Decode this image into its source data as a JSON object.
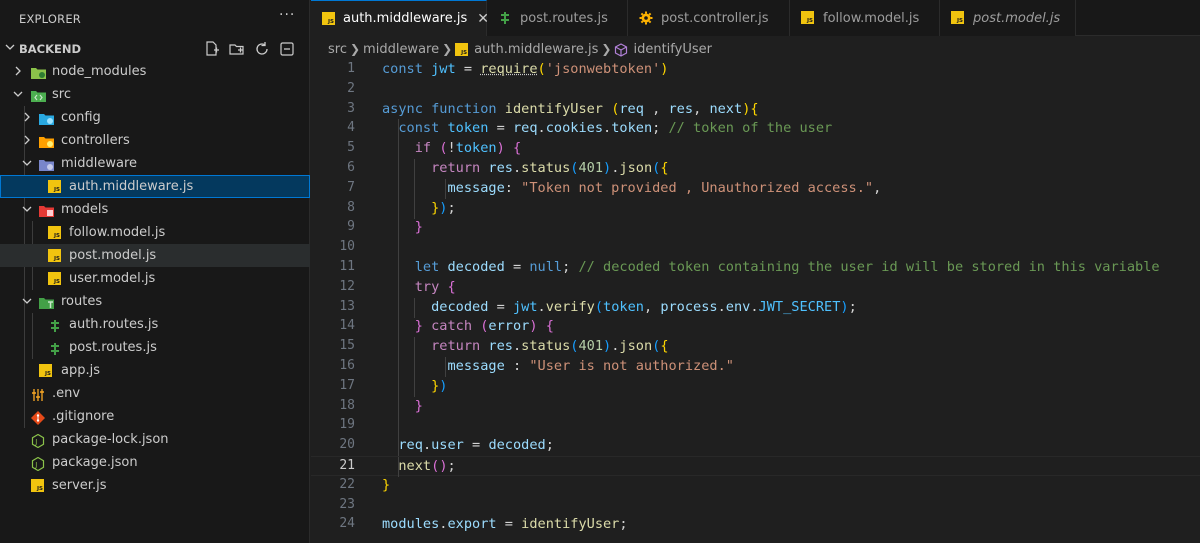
{
  "explorer": {
    "title": "EXPLORER",
    "more": "···",
    "root": "BACKEND",
    "tree": [
      {
        "label": "node_modules",
        "icon": "node-folder-icon"
      },
      {
        "label": "src",
        "icon": "src-folder-icon"
      },
      {
        "label": "config",
        "icon": "config-folder-icon"
      },
      {
        "label": "controllers",
        "icon": "controllers-folder-icon"
      },
      {
        "label": "middleware",
        "icon": "middleware-folder-icon"
      },
      {
        "label": "auth.middleware.js",
        "icon": "js-file-icon"
      },
      {
        "label": "models",
        "icon": "models-folder-icon"
      },
      {
        "label": "follow.model.js",
        "icon": "js-file-icon"
      },
      {
        "label": "post.model.js",
        "icon": "js-file-icon"
      },
      {
        "label": "user.model.js",
        "icon": "js-file-icon"
      },
      {
        "label": "routes",
        "icon": "routes-folder-icon"
      },
      {
        "label": "auth.routes.js",
        "icon": "routes-file-icon"
      },
      {
        "label": "post.routes.js",
        "icon": "routes-file-icon"
      },
      {
        "label": "app.js",
        "icon": "js-file-icon"
      },
      {
        "label": ".env",
        "icon": "env-file-icon"
      },
      {
        "label": ".gitignore",
        "icon": "git-icon"
      },
      {
        "label": "package-lock.json",
        "icon": "npm-file-icon"
      },
      {
        "label": "package.json",
        "icon": "npm-file-icon"
      },
      {
        "label": "server.js",
        "icon": "js-file-icon"
      }
    ]
  },
  "tabs": [
    {
      "label": "auth.middleware.js",
      "icon": "js-file-icon",
      "close": "✕"
    },
    {
      "label": "post.routes.js",
      "icon": "routes-file-icon"
    },
    {
      "label": "post.controller.js",
      "icon": "gear-icon"
    },
    {
      "label": "follow.model.js",
      "icon": "js-file-icon"
    },
    {
      "label": "post.model.js",
      "icon": "js-file-icon"
    }
  ],
  "breadcrumb": {
    "src": "src",
    "folder": "middleware",
    "file": "auth.middleware.js",
    "symbol": "identifyUser"
  },
  "editor": {
    "line_numbers": [
      "1",
      "2",
      "3",
      "4",
      "5",
      "6",
      "7",
      "8",
      "9",
      "10",
      "11",
      "12",
      "13",
      "14",
      "15",
      "16",
      "17",
      "18",
      "19",
      "20",
      "21",
      "22",
      "23",
      "24"
    ],
    "current_line": "21",
    "code": {
      "l1_kw": "const",
      "l1_var": "jwt",
      "l1_eq": " = ",
      "l1_fn": "require",
      "l1_po": "(",
      "l1_str": "'jsonwebtoken'",
      "l1_pc": ")",
      "l3_async": "async",
      "l3_function": "function",
      "l3_name": "identifyUser",
      "l3_po": "(",
      "l3_req": "req",
      "l3_c1": " , ",
      "l3_res": "res",
      "l3_c2": ", ",
      "l3_next": "next",
      "l3_pc": ")",
      "l3_bo": "{",
      "l4_kw": "const",
      "l4_var": "token",
      "l4_eq": " = ",
      "l4_obj": "req",
      "l4_d1": ".",
      "l4_prop": "cookies",
      "l4_d2": ".",
      "l4_prop2": "token",
      "l4_semi": "; ",
      "l4_comment": "// token of the user",
      "l5_if": "if",
      "l5_po": "(",
      "l5_not": "!",
      "l5_tok": "token",
      "l5_pc": ")",
      "l5_bo": "{",
      "l6_ret": "return",
      "l6_res": "res",
      "l6_d": ".",
      "l6_status": "status",
      "l6_po": "(",
      "l6_num": "401",
      "l6_pc": ")",
      "l6_d2": ".",
      "l6_json": "json",
      "l6_po2": "(",
      "l6_bo": "{",
      "l7_key": "message",
      "l7_colon": ": ",
      "l7_str": "\"Token not provided , Unauthorized access.\"",
      "l7_comma": ",",
      "l8_bc": "}",
      "l8_pc": ")",
      "l8_semi": ";",
      "l9_bc": "}",
      "l11_let": "let",
      "l11_var": "decoded",
      "l11_eq": " = ",
      "l11_null": "null",
      "l11_semi": "; ",
      "l11_comment": "// decoded token containing the user id will be stored in this variable",
      "l12_try": "try",
      "l12_bo": "{",
      "l13_var": "decoded",
      "l13_eq": " = ",
      "l13_jwt": "jwt",
      "l13_d": ".",
      "l13_verify": "verify",
      "l13_po": "(",
      "l13_token": "token",
      "l13_c": ", ",
      "l13_process": "process",
      "l13_d2": ".",
      "l13_env": "env",
      "l13_d3": ".",
      "l13_secret": "JWT_SECRET",
      "l13_pc": ")",
      "l13_semi": ";",
      "l14_bc": "}",
      "l14_catch": "catch",
      "l14_po": "(",
      "l14_err": "error",
      "l14_pc": ")",
      "l14_bo": "{",
      "l15_ret": "return",
      "l15_res": "res",
      "l15_d": ".",
      "l15_status": "status",
      "l15_po": "(",
      "l15_num": "401",
      "l15_pc": ")",
      "l15_d2": ".",
      "l15_json": "json",
      "l15_po2": "(",
      "l15_bo": "{",
      "l16_key": "message",
      "l16_colon": " : ",
      "l16_str": "\"User is not authorized.\"",
      "l17_bc": "}",
      "l17_pc": ")",
      "l18_bc": "}",
      "l20_req": "req",
      "l20_d": ".",
      "l20_user": "user",
      "l20_eq": " = ",
      "l20_dec": "decoded",
      "l20_semi": ";",
      "l21_next": "next",
      "l21_po": "(",
      "l21_pc": ")",
      "l21_semi": ";",
      "l22_bc": "}",
      "l24_mod": "modules",
      "l24_d": ".",
      "l24_exp": "export",
      "l24_eq": " = ",
      "l24_id": "identifyUser",
      "l24_semi": ";"
    }
  }
}
